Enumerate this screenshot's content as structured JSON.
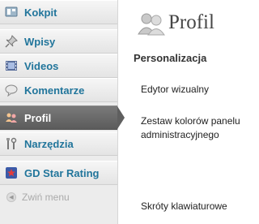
{
  "sidebar": {
    "items": [
      {
        "label": "Kokpit",
        "icon": "dashboard-icon"
      },
      {
        "label": "Wpisy",
        "icon": "pushpin-icon"
      },
      {
        "label": "Videos",
        "icon": "film-icon"
      },
      {
        "label": "Komentarze",
        "icon": "comment-bubble-icon"
      },
      {
        "label": "Profil",
        "icon": "users-icon",
        "active": true
      },
      {
        "label": "Narzędzia",
        "icon": "tools-icon"
      },
      {
        "label": "GD Star Rating",
        "icon": "star-rating-icon"
      }
    ],
    "collapse_label": "Zwiń menu"
  },
  "page": {
    "title": "Profil",
    "section_heading": "Personalizacja",
    "options": [
      "Edytor wizualny",
      "Zestaw kolorów panelu administracyjnego",
      "Skróty klawiaturowe"
    ]
  },
  "colors": {
    "link": "#21759b",
    "active_bg": "#6d6d6d",
    "sidebar_bg": "#ececec"
  }
}
